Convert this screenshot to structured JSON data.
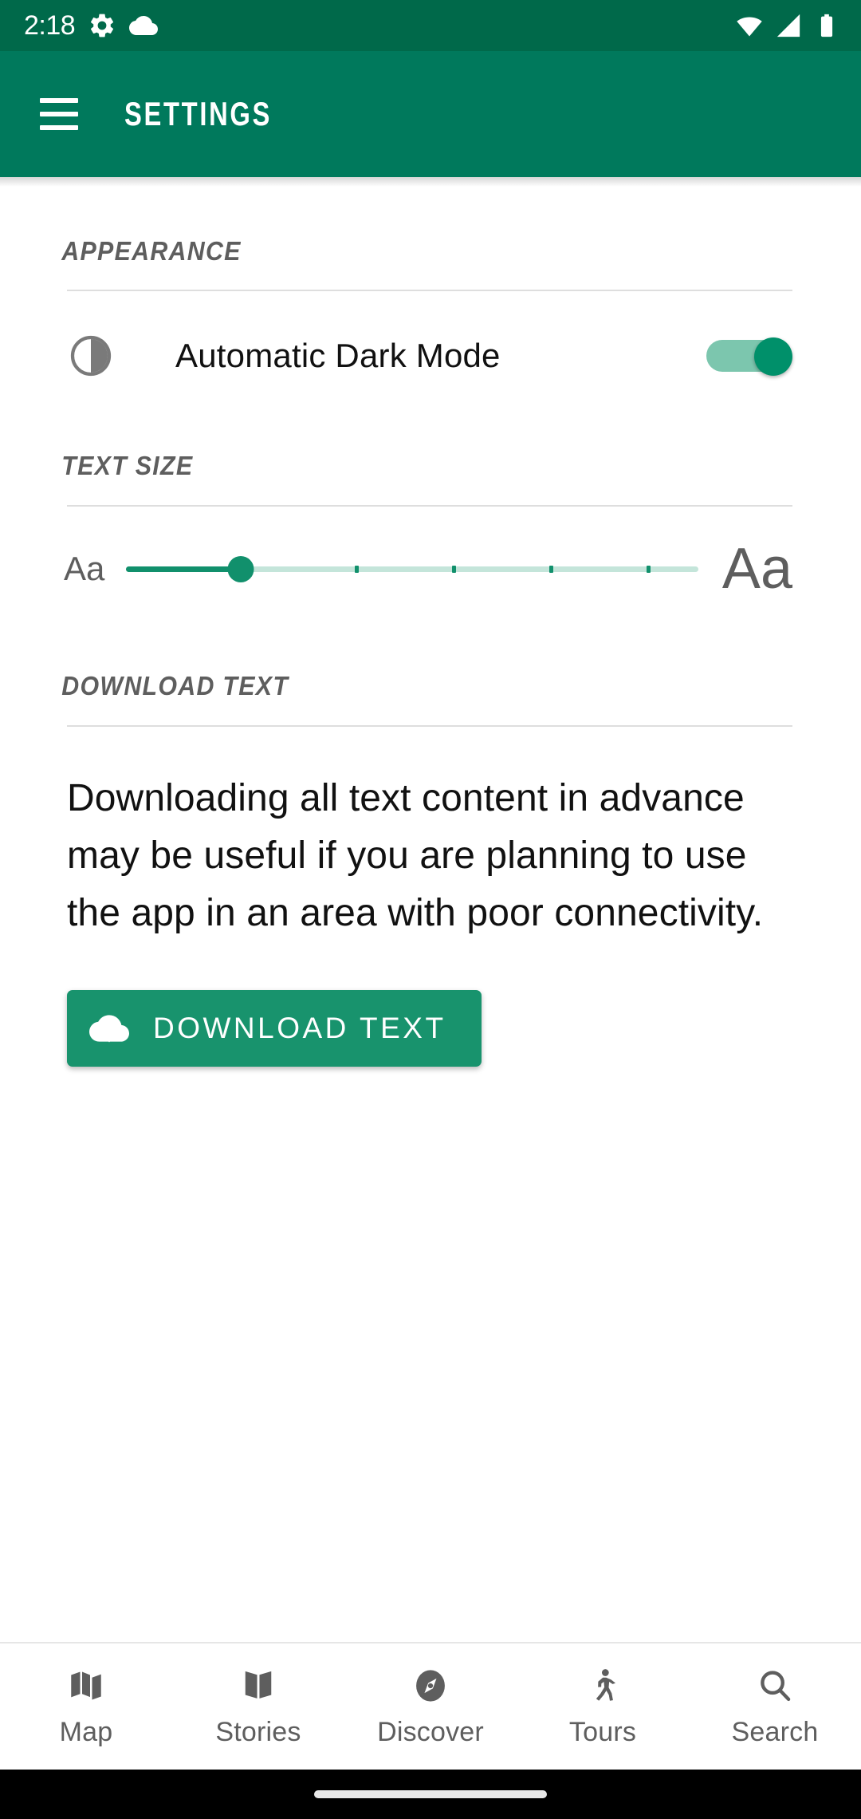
{
  "status_bar": {
    "time": "2:18",
    "left_icons": [
      "settings-gear-icon",
      "cloud-icon"
    ],
    "right_icons": [
      "wifi-icon",
      "cellular-signal-icon",
      "battery-full-icon"
    ],
    "background_color": "#00694a",
    "foreground_color": "#ffffff"
  },
  "app_bar": {
    "title": "SETTINGS",
    "menu_icon": "hamburger-menu-icon",
    "background_color": "#00795c",
    "title_color": "#ffffff"
  },
  "sections": {
    "appearance": {
      "header": "APPEARANCE",
      "dark_mode": {
        "icon": "contrast-half-circle-icon",
        "label": "Automatic Dark Mode",
        "enabled": true,
        "state_text": "on",
        "track_color": "#7cc6ae",
        "thumb_color": "#00906a"
      }
    },
    "text_size": {
      "header": "TEXT SIZE",
      "small_sample": "Aa",
      "large_sample": "Aa",
      "slider": {
        "min": 0,
        "max": 5,
        "value": 1,
        "tick_count": 6,
        "active_color": "#11906c",
        "rail_color": "#c4e5da"
      }
    },
    "download_text": {
      "header": "DOWNLOAD TEXT",
      "description": "Downloading all text content in advance may be useful if you are planning to use the app in an area with poor connectivity.",
      "button": {
        "label": "DOWNLOAD TEXT",
        "icon": "cloud-download-icon",
        "background_color": "#18936d",
        "text_color": "#ffffff"
      }
    }
  },
  "bottom_nav": {
    "items": [
      {
        "label": "Map",
        "icon": "map-folded-icon"
      },
      {
        "label": "Stories",
        "icon": "open-book-icon"
      },
      {
        "label": "Discover",
        "icon": "compass-icon"
      },
      {
        "label": "Tours",
        "icon": "walking-person-icon"
      },
      {
        "label": "Search",
        "icon": "magnifier-icon"
      }
    ],
    "color": "#5e5e5e"
  },
  "gesture_bar": {
    "background_color": "#000000",
    "pill_color": "#e8e8e8"
  }
}
